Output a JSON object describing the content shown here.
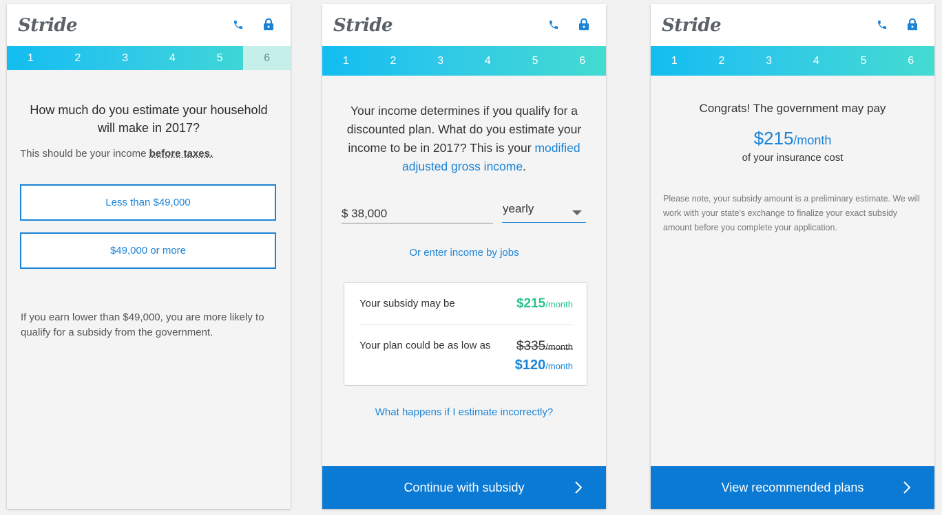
{
  "brand": {
    "logo_text": "Stride",
    "accent": "#1b83d6",
    "green": "#2bc48a",
    "cta_bg": "#0b7ad4"
  },
  "header": {
    "phone_icon": "phone-icon",
    "lock_icon": "lock-icon"
  },
  "steps": [
    "1",
    "2",
    "3",
    "4",
    "5",
    "6"
  ],
  "screen1": {
    "question": "How much do you estimate your household will make in 2017?",
    "note_prefix": "This should be your income ",
    "note_bold": "before taxes.",
    "options": [
      "Less than $49,000",
      "$49,000 or more"
    ],
    "footnote": "If you earn lower than $49,000, you are more likely to qualify for a subsidy from the government."
  },
  "screen2": {
    "intro_text": "Your income determines if you qualify for a discounted plan. What do you estimate your income to be in 2017? This is your ",
    "intro_link": "modified adjusted gross income",
    "intro_end": ".",
    "income_value": "$ 38,000",
    "period_value": "yearly",
    "jobs_link": "Or enter income by jobs",
    "subsidy_label": "Your subsidy may be",
    "subsidy_amount": "$215",
    "per_month": "/month",
    "plan_label": "Your plan could be as low as",
    "plan_old": "$335",
    "plan_new": "$120",
    "estimate_link": "What happens if I estimate incorrectly?",
    "cta": "Continue with subsidy"
  },
  "screen3": {
    "congrats": "Congrats! The government may pay",
    "amount": "$215",
    "per_month": "/month",
    "cost_text": "of your insurance cost",
    "disclaimer": "Please note, your subsidy amount is a preliminary estimate. We will work with your state's exchange to finalize your exact subsidy amount before you complete your application.",
    "cta": "View recommended plans"
  }
}
